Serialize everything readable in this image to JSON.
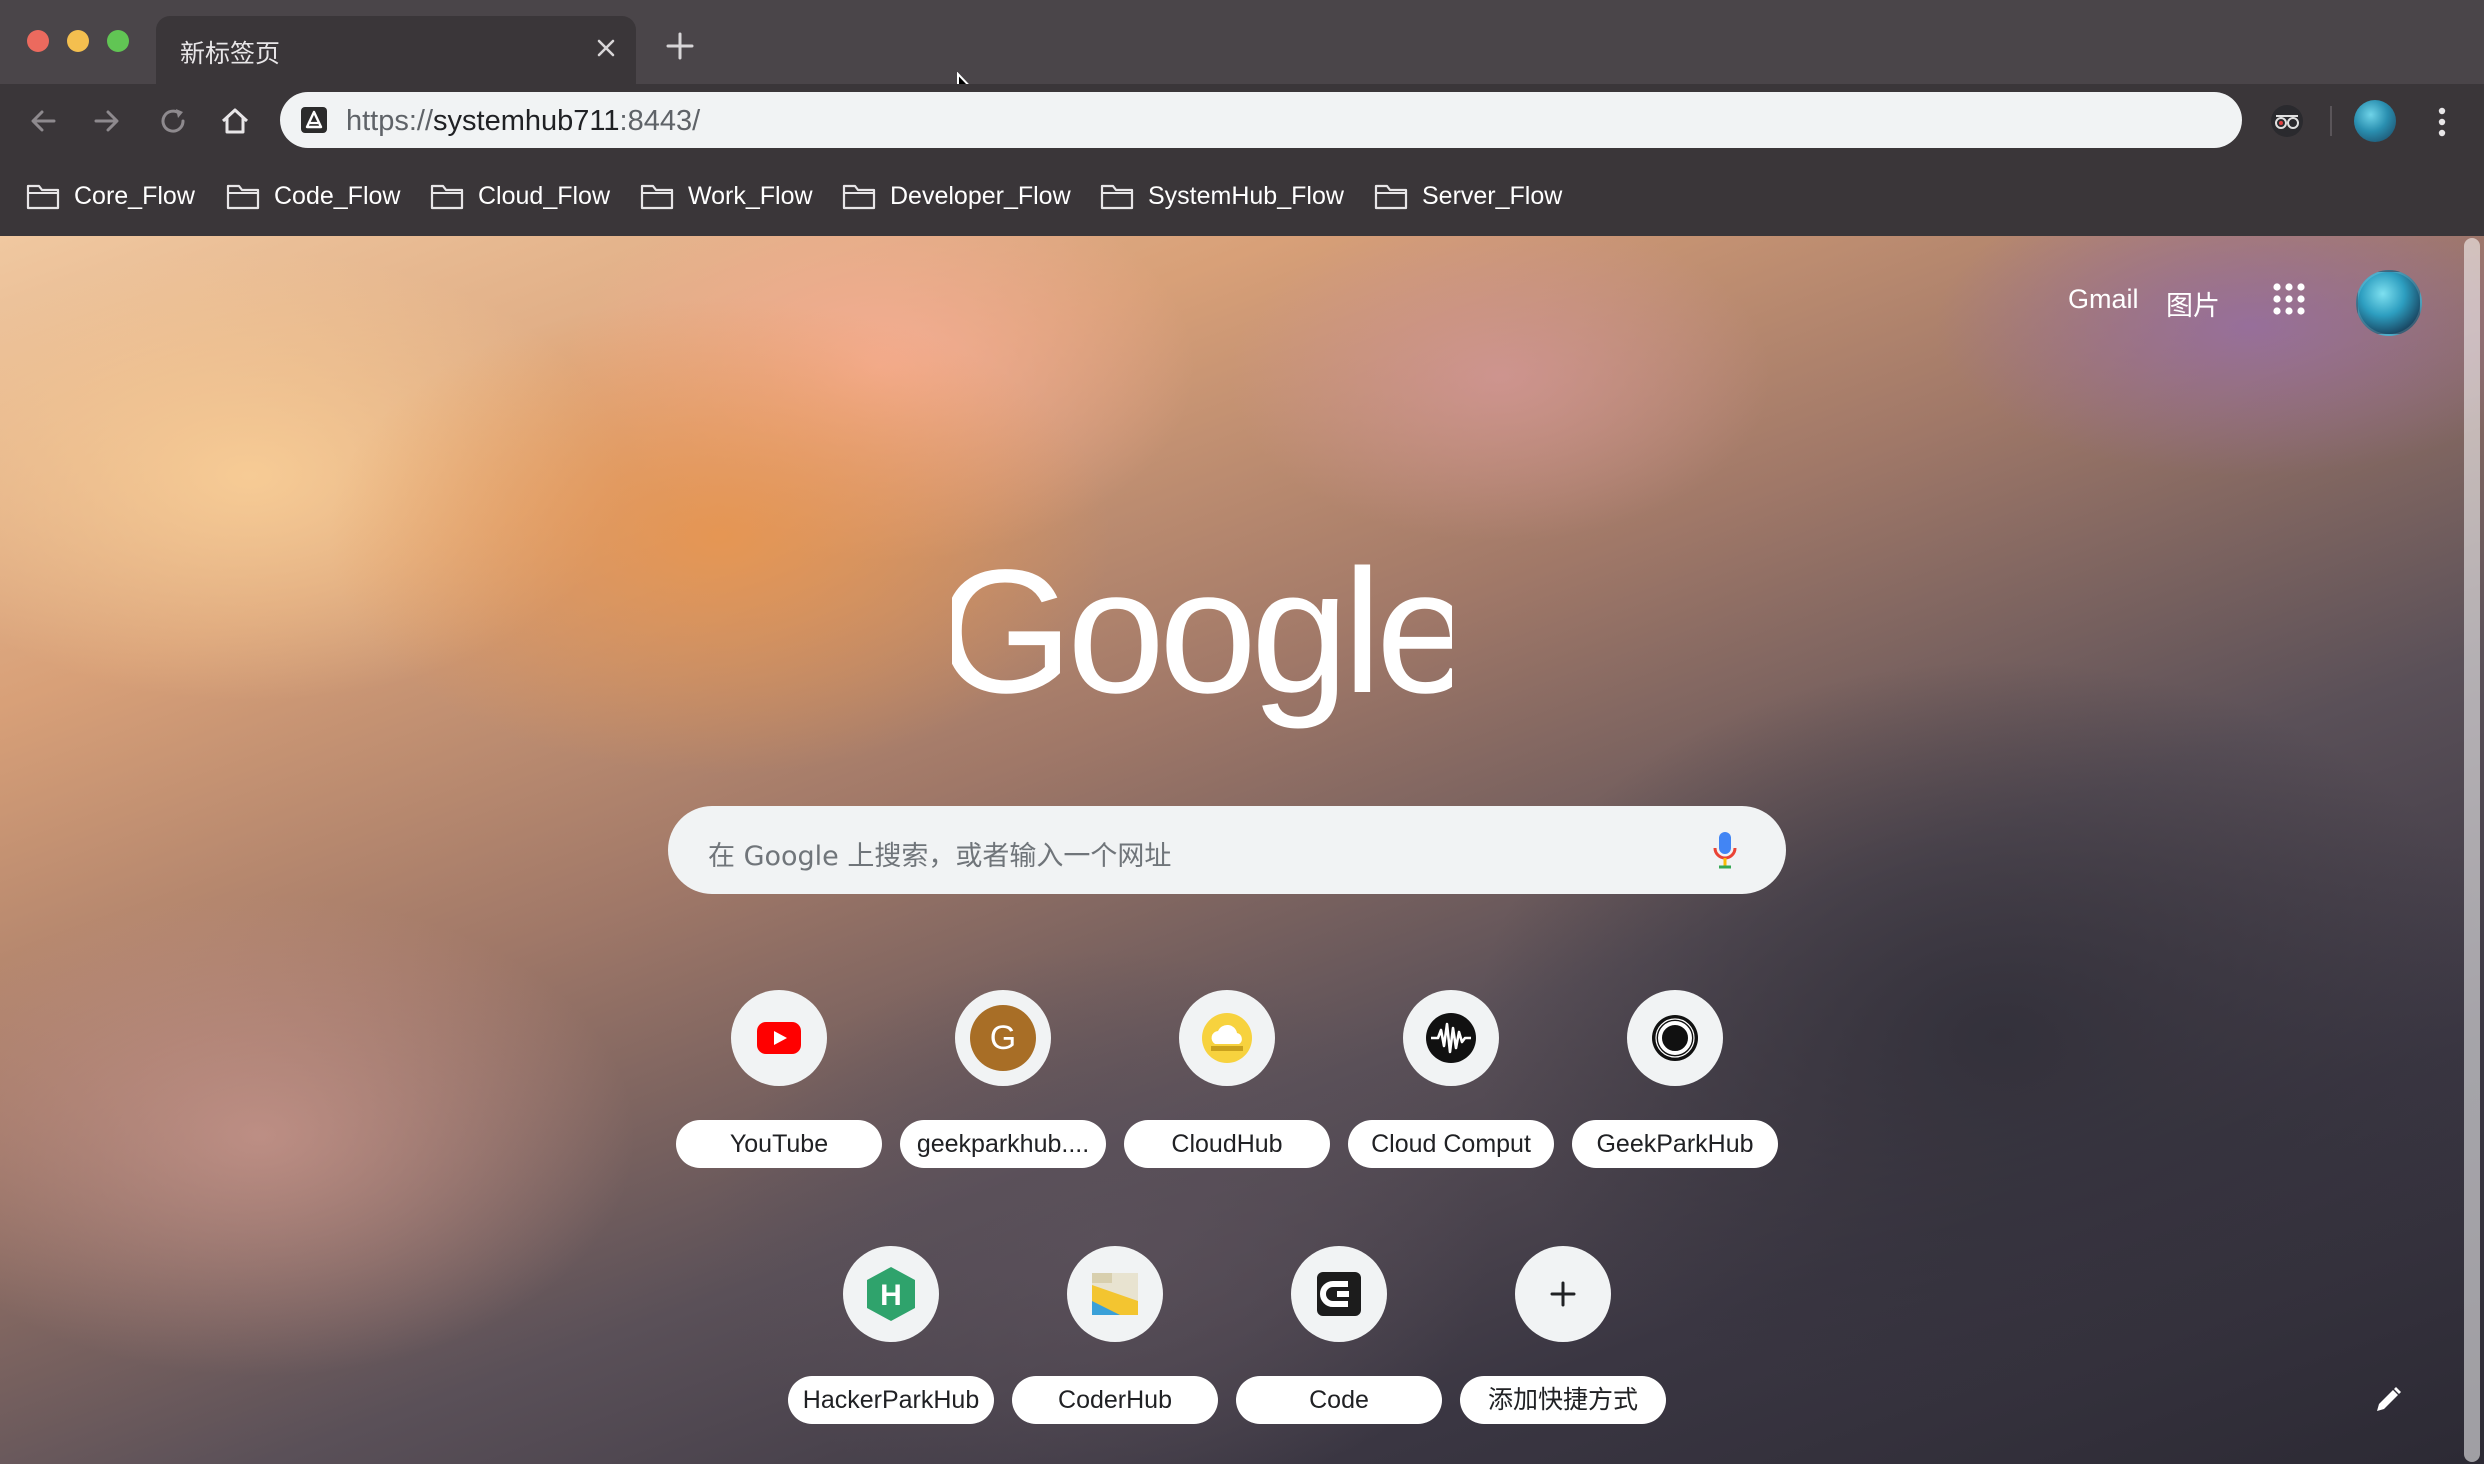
{
  "tab": {
    "title": "新标签页"
  },
  "address_bar": {
    "scheme": "https://",
    "host": "systemhub711",
    "port": ":8443/"
  },
  "bookmarks": [
    {
      "label": "Core_Flow"
    },
    {
      "label": "Code_Flow"
    },
    {
      "label": "Cloud_Flow"
    },
    {
      "label": "Work_Flow"
    },
    {
      "label": "Developer_Flow"
    },
    {
      "label": "SystemHub_Flow"
    },
    {
      "label": "Server_Flow"
    }
  ],
  "header": {
    "gmail": "Gmail",
    "images": "图片"
  },
  "logo": {
    "text": "Google"
  },
  "search": {
    "placeholder": "在 Google 上搜索，或者输入一个网址"
  },
  "shortcuts": [
    {
      "label": "YouTube",
      "icon": "youtube-icon",
      "letter": ""
    },
    {
      "label": "geekparkhub....",
      "icon": "letter-g-icon",
      "letter": "G"
    },
    {
      "label": "CloudHub",
      "icon": "cloud-icon",
      "letter": ""
    },
    {
      "label": "Cloud Comput",
      "icon": "waveform-icon",
      "letter": ""
    },
    {
      "label": "GeekParkHub",
      "icon": "ring-icon",
      "letter": ""
    },
    {
      "label": "HackerParkHub",
      "icon": "hexagon-h-icon",
      "letter": "H"
    },
    {
      "label": "CoderHub",
      "icon": "coderhub-icon",
      "letter": ""
    },
    {
      "label": "Code",
      "icon": "code-c-icon",
      "letter": ""
    },
    {
      "label": "添加快捷方式",
      "icon": "plus-icon",
      "letter": ""
    }
  ],
  "colors": {
    "google_blue": "#ffffff",
    "youtube_red": "#ff0000",
    "mic_blue": "#4285f4",
    "mic_red": "#ea4335",
    "mic_yellow": "#fbbc05",
    "mic_green": "#34a853"
  }
}
